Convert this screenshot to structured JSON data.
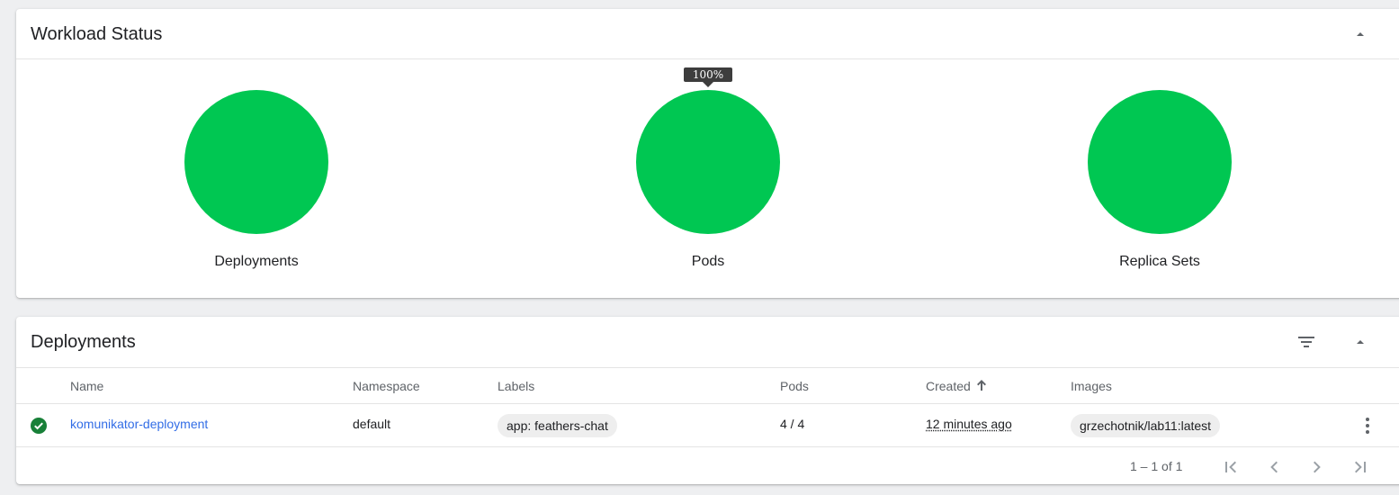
{
  "workload": {
    "title": "Workload Status",
    "tooltip": "100%",
    "charts": [
      {
        "label": "Deployments",
        "running_percent": 100,
        "color": "#00c752"
      },
      {
        "label": "Pods",
        "running_percent": 100,
        "color": "#00c752"
      },
      {
        "label": "Replica Sets",
        "running_percent": 100,
        "color": "#00c752"
      }
    ]
  },
  "deployments": {
    "title": "Deployments",
    "columns": [
      "Name",
      "Namespace",
      "Labels",
      "Pods",
      "Created",
      "Images"
    ],
    "sort_icon": "arrow-up-icon",
    "rows": [
      {
        "status": "success",
        "name": "komunikator-deployment",
        "namespace": "default",
        "label": "app: feathers-chat",
        "pods": "4 / 4",
        "created": "12 minutes ago",
        "image": "grzechotnik/lab11:latest"
      }
    ],
    "pagination": "1 – 1 of 1"
  },
  "colors": {
    "accent": "#326de6",
    "success": "#00c752",
    "status_check": "#188038"
  }
}
